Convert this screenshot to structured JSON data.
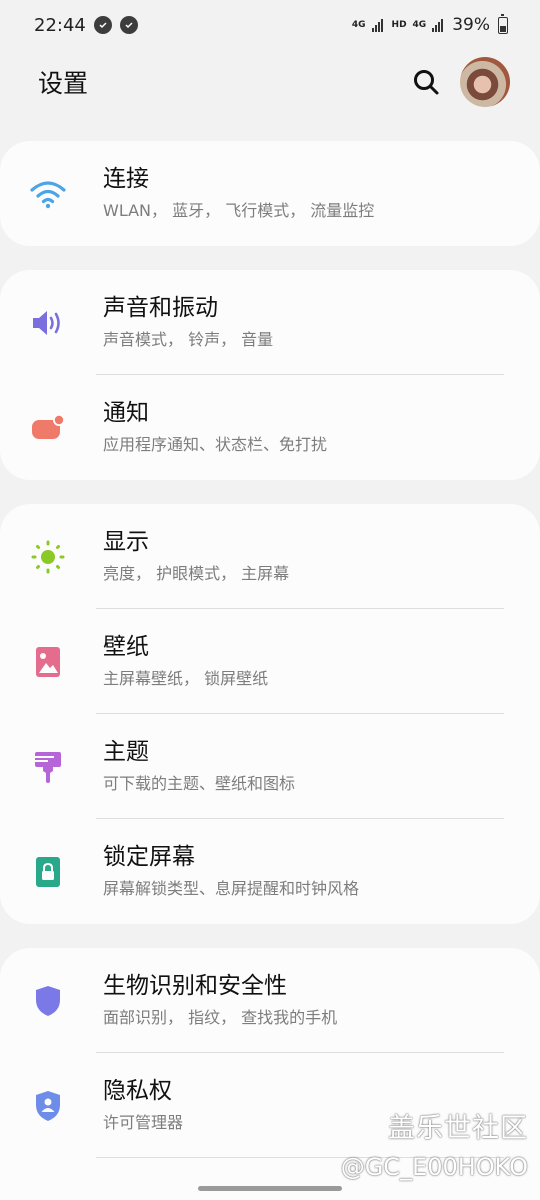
{
  "status_bar": {
    "time": "22:44",
    "net1": "4G",
    "hd": "HD",
    "net2": "4G",
    "battery": "39%"
  },
  "header": {
    "title": "设置"
  },
  "groups": [
    {
      "items": [
        {
          "title": "连接",
          "subtitle": "WLAN， 蓝牙， 飞行模式， 流量监控",
          "icon": "wifi-icon"
        }
      ]
    },
    {
      "items": [
        {
          "title": "声音和振动",
          "subtitle": "声音模式， 铃声， 音量",
          "icon": "speaker-icon"
        },
        {
          "title": "通知",
          "subtitle": "应用程序通知、状态栏、免打扰",
          "icon": "notification-icon"
        }
      ]
    },
    {
      "items": [
        {
          "title": "显示",
          "subtitle": "亮度， 护眼模式， 主屏幕",
          "icon": "sun-icon"
        },
        {
          "title": "壁纸",
          "subtitle": "主屏幕壁纸， 锁屏壁纸",
          "icon": "wallpaper-icon"
        },
        {
          "title": "主题",
          "subtitle": "可下载的主题、壁纸和图标",
          "icon": "brush-icon"
        },
        {
          "title": "锁定屏幕",
          "subtitle": "屏幕解锁类型、息屏提醒和时钟风格",
          "icon": "lock-icon"
        }
      ]
    },
    {
      "items": [
        {
          "title": "生物识别和安全性",
          "subtitle": "面部识别， 指纹， 查找我的手机",
          "icon": "shield-icon"
        },
        {
          "title": "隐私权",
          "subtitle": "许可管理器",
          "icon": "privacy-shield-icon"
        }
      ]
    }
  ],
  "watermark": {
    "line1": "盖乐世社区",
    "line2": "@GC_E00HOKO"
  },
  "colors": {
    "wifi": "#4ba3e8",
    "speaker": "#7b6fe0",
    "notification": "#f07a6a",
    "sun": "#8ac926",
    "wallpaper": "#e46c8c",
    "brush": "#b565d8",
    "lock": "#2aa88a",
    "shield": "#7b78e8",
    "privacy": "#6e8de8"
  }
}
